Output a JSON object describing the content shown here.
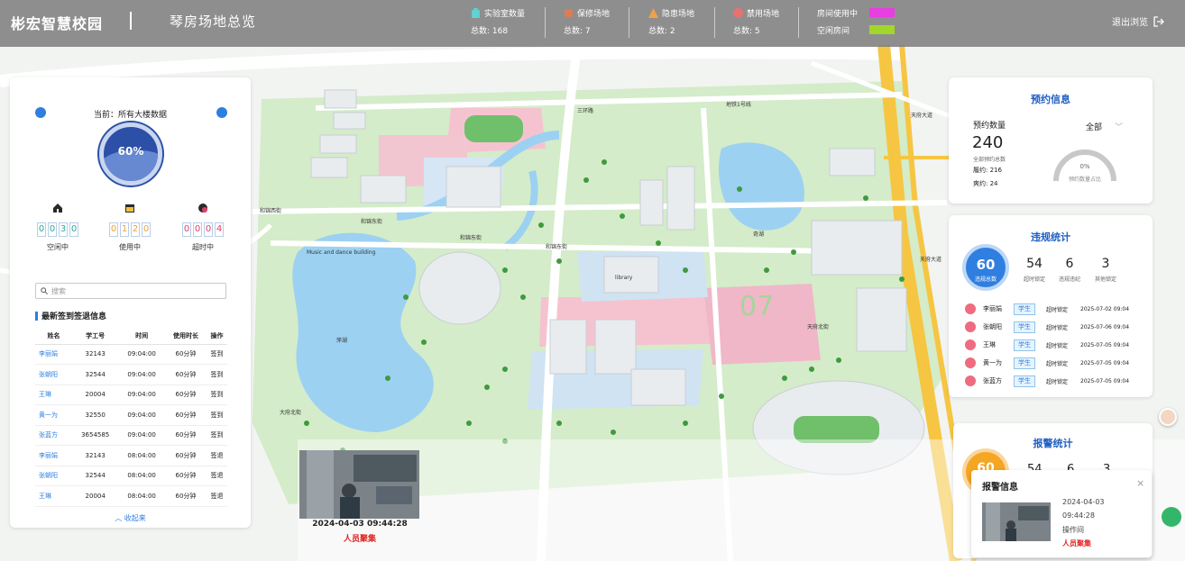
{
  "header": {
    "brand": "彬宏智慧校园",
    "page_title": "琴房场地总览",
    "stats": [
      {
        "label": "实验室数量",
        "value": "总数: 168",
        "icon": "building-icon",
        "color": "#5fd3d3"
      },
      {
        "label": "保修场地",
        "value": "总数: 7",
        "icon": "repair-icon",
        "color": "#e07a55"
      },
      {
        "label": "隐患场地",
        "value": "总数: 2",
        "icon": "warning-icon",
        "color": "#f0a14a"
      },
      {
        "label": "禁用场地",
        "value": "总数: 5",
        "icon": "ban-icon",
        "color": "#e8736e"
      }
    ],
    "legend": [
      {
        "label": "房间使用中",
        "color": "#e83de0"
      },
      {
        "label": "空闲房间",
        "color": "#a3d62a"
      }
    ],
    "logout_label": "退出浏览"
  },
  "left_panel": {
    "current_label": "当前：所有大楼数据",
    "gauge_value": "60%",
    "counters": [
      {
        "icon": "home-icon",
        "digits": [
          "0",
          "0",
          "3",
          "0"
        ],
        "label": "空闲中",
        "color": "#2aa8a8"
      },
      {
        "icon": "calendar-icon",
        "digits": [
          "0",
          "1",
          "2",
          "0"
        ],
        "label": "使用中",
        "color": "#e8a23a"
      },
      {
        "icon": "clock-alert-icon",
        "digits": [
          "0",
          "0",
          "0",
          "4"
        ],
        "label": "超时中",
        "color": "#e0406a"
      }
    ],
    "search_placeholder": "搜索",
    "section_title": "最新签到签退信息",
    "columns": [
      "姓名",
      "学工号",
      "时间",
      "使用时长",
      "操作"
    ],
    "rows": [
      [
        "李丽娟",
        "32143",
        "09:04:00",
        "60分钟",
        "签到"
      ],
      [
        "张朝阳",
        "32544",
        "09:04:00",
        "60分钟",
        "签到"
      ],
      [
        "王琳",
        "20004",
        "09:04:00",
        "60分钟",
        "签到"
      ],
      [
        "黄一为",
        "32550",
        "09:04:00",
        "60分钟",
        "签到"
      ],
      [
        "张蓝方",
        "3654585",
        "09:04:00",
        "60分钟",
        "签到"
      ],
      [
        "李丽娟",
        "32143",
        "08:04:00",
        "60分钟",
        "签退"
      ],
      [
        "张朝阳",
        "32544",
        "08:04:00",
        "60分钟",
        "签退"
      ],
      [
        "王琳",
        "20004",
        "08:04:00",
        "60分钟",
        "签退"
      ]
    ],
    "collapse_label": "收起来"
  },
  "video": {
    "timestamp": "2024-04-03 09:44:28",
    "alarm": "人员聚集"
  },
  "booking": {
    "title": "预约信息",
    "count_label": "预约数量",
    "filter_value": "全部",
    "total": "240",
    "total_sub": "全部预约总数",
    "fulfilled": "履约: 216",
    "broken": "爽约: 24",
    "ratio_value": "0%",
    "ratio_label": "预约数量占比"
  },
  "violations": {
    "title": "违规统计",
    "total": "60",
    "total_label": "违规总数",
    "stats": [
      {
        "value": "54",
        "label": "超时锁定"
      },
      {
        "value": "6",
        "label": "违规违纪"
      },
      {
        "value": "3",
        "label": "其他锁定"
      }
    ],
    "rows": [
      {
        "name": "李丽娟",
        "tag": "学生",
        "reason": "超时锁定",
        "date": "2025-07-02 09:04"
      },
      {
        "name": "张朝阳",
        "tag": "学生",
        "reason": "超时锁定",
        "date": "2025-07-06 09:04"
      },
      {
        "name": "王琳",
        "tag": "学生",
        "reason": "超时锁定",
        "date": "2025-07-05 09:04"
      },
      {
        "name": "黄一为",
        "tag": "学生",
        "reason": "超时锁定",
        "date": "2025-07-05 09:04"
      },
      {
        "name": "张蓝方",
        "tag": "学生",
        "reason": "超时锁定",
        "date": "2025-07-05 09:04"
      }
    ]
  },
  "alarm_stats": {
    "title": "报警统计",
    "total": "60",
    "stats": [
      "54",
      "6",
      "3"
    ]
  },
  "alarm_popup": {
    "title": "报警信息",
    "date": "2024-04-03",
    "time": "09:44:28",
    "location": "操作间",
    "type": "人员聚集"
  },
  "map_labels": [
    "三环路",
    "地铁1号线",
    "天府大道",
    "和锦西街",
    "和锦东街",
    "和锦东街",
    "和锦东街",
    "天府大道",
    "奇湖",
    "萍湖",
    "Music and dance building",
    "天府北街",
    "大府北街",
    "library",
    "07"
  ]
}
